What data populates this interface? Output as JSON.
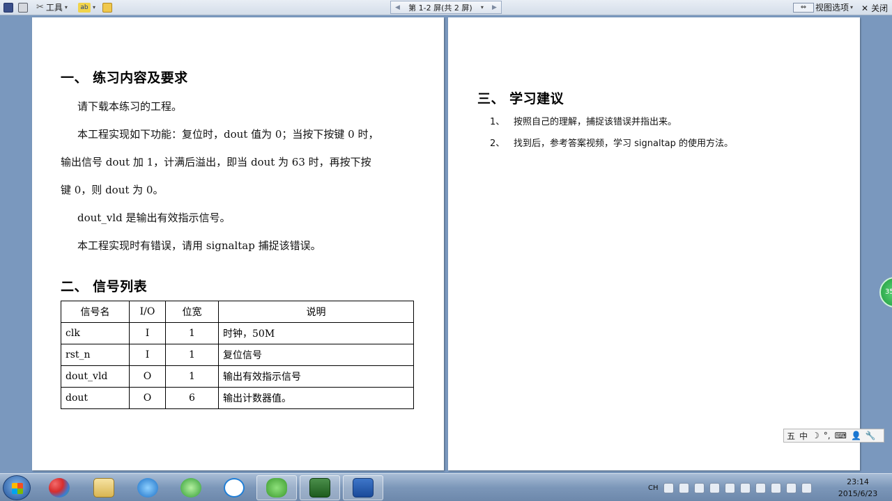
{
  "toolbar": {
    "tools_label": "工具",
    "pager_label": "第 1-2 屏(共 2 屏)",
    "view_options_label": "视图选项",
    "close_label": "关闭",
    "abc_text": "ab"
  },
  "doc": {
    "section1_title": "一、 练习内容及要求",
    "section1_paragraphs": [
      "请下载本练习的工程。",
      "本工程实现如下功能：复位时，dout 值为 0；当按下按键 0 时，",
      "输出信号 dout 加 1，计满后溢出，即当 dout 为 63 时，再按下按",
      "键 0，则 dout 为 0。",
      "dout_vld 是输出有效指示信号。",
      "本工程实现时有错误，请用 signaltap 捕捉该错误。"
    ],
    "section2_title": "二、 信号列表",
    "table": {
      "headers": [
        "信号名",
        "I/O",
        "位宽",
        "说明"
      ],
      "rows": [
        [
          "clk",
          "I",
          "1",
          "时钟，50M"
        ],
        [
          "rst_n",
          "I",
          "1",
          "复位信号"
        ],
        [
          "dout_vld",
          "O",
          "1",
          "输出有效指示信号"
        ],
        [
          "dout",
          "O",
          "6",
          "输出计数器值。"
        ]
      ]
    },
    "section3_title": "三、 学习建议",
    "suggestions": [
      {
        "num": "1、",
        "text": "按照自己的理解，捕捉该错误并指出来。"
      },
      {
        "num": "2、",
        "text": "找到后，参考答案视频，学习 signaltap 的使用方法。"
      }
    ]
  },
  "side_badge": "35",
  "ime": [
    "五",
    "中",
    "☽",
    "°,",
    "⌨",
    "👤",
    "🔧"
  ],
  "taskbar": {
    "tray_lang": "CH",
    "time": "23:14",
    "date": "2015/6/23"
  }
}
